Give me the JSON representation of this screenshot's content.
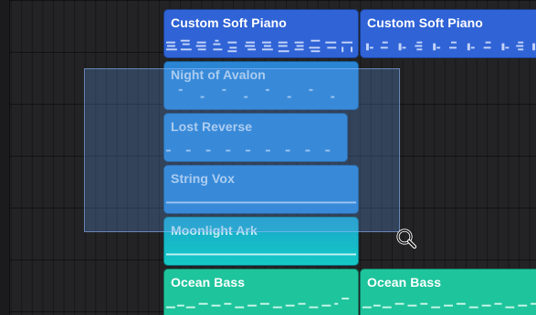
{
  "tracks": [
    {
      "regions": [
        {
          "name": "Custom Soft Piano"
        },
        {
          "name": "Custom Soft Piano"
        }
      ]
    },
    {
      "regions": [
        {
          "name": "Night of Avalon"
        }
      ]
    },
    {
      "regions": [
        {
          "name": "Lost Reverse"
        }
      ]
    },
    {
      "regions": [
        {
          "name": "String Vox"
        }
      ]
    },
    {
      "regions": [
        {
          "name": "Moonlight Ark"
        }
      ]
    },
    {
      "regions": [
        {
          "name": "Ocean Bass"
        },
        {
          "name": "Ocean Bass"
        }
      ]
    }
  ],
  "colors": {
    "piano": "#2f63d6",
    "blue": "#2a86d4",
    "cyan": "#14c9c6",
    "green": "#1ec49c",
    "selection": "#5f96e6",
    "background": "#232325"
  },
  "cursor": {
    "icon": "zoom-magnifier-icon"
  }
}
